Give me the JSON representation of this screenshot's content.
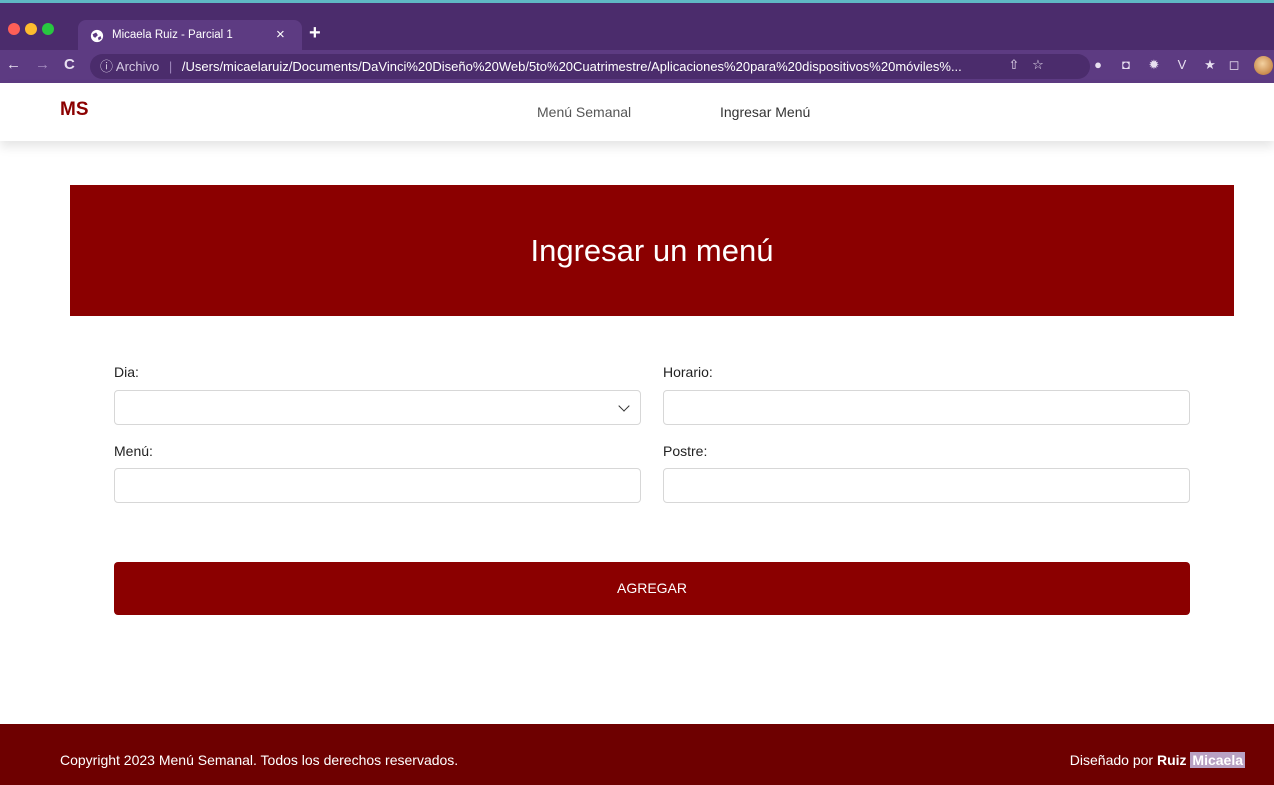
{
  "browser": {
    "tab_title": "Micaela Ruiz - Parcial 1",
    "tab_close": "×",
    "new_tab": "+",
    "url_info_label": "ⓘ Archivo",
    "url_separator": "|",
    "url": "/Users/micaelaruiz/Documents/DaVinci%20Diseño%20Web/5to%20Cuatrimestre/Aplicaciones%20para%20dispositivos%20móviles%...",
    "nav_back": "←",
    "nav_forward": "→",
    "nav_reload": "C"
  },
  "header": {
    "brand": "MS",
    "nav": {
      "menu_semanal": "Menú Semanal",
      "ingresar_menu": "Ingresar Menú"
    }
  },
  "hero": {
    "title": "Ingresar un menú"
  },
  "form": {
    "dia_label": "Dia:",
    "dia_value": "",
    "horario_label": "Horario:",
    "horario_value": "",
    "menu_label": "Menú:",
    "menu_value": "",
    "postre_label": "Postre:",
    "postre_value": "",
    "submit_label": "AGREGAR"
  },
  "footer": {
    "copyright": "Copyright 2023 Menú Semanal. Todos los derechos reservados.",
    "designed_by_prefix": "Diseñado por ",
    "designer_last": "Ruiz",
    "designer_first": "Micaela"
  },
  "colors": {
    "brand": "#8b0000",
    "footer": "#6e0000",
    "browser_frame": "#4b2c6c"
  }
}
